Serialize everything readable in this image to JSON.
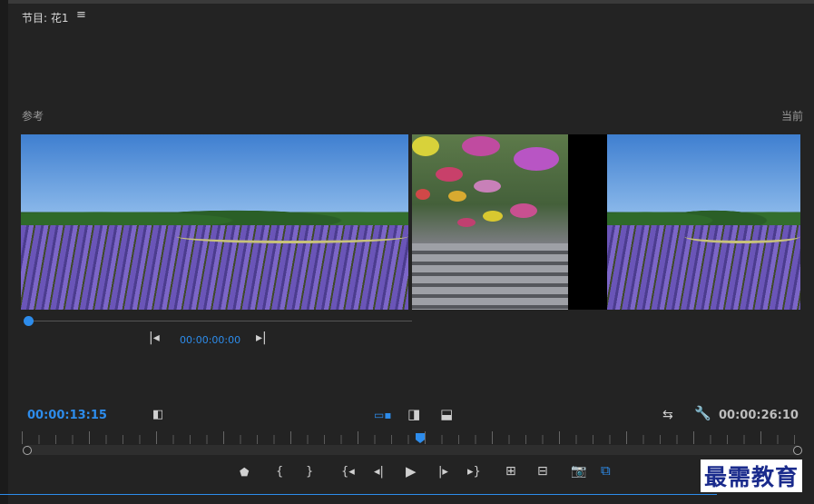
{
  "header": {
    "title": "节目: 花1",
    "menu_icon": "hamburger-icon"
  },
  "labels": {
    "reference": "参考",
    "current": "当前"
  },
  "reference_panel": {
    "timecode": "00:00:00:00",
    "playhead_progress": 0
  },
  "timecode": {
    "current": "00:00:13:15",
    "duration": "00:00:26:10"
  },
  "timeline": {
    "playhead_progress": 0.51
  },
  "watermark": {
    "text": "最需教育"
  },
  "colors": {
    "accent": "#2d8ceb",
    "background": "#232323"
  },
  "controls": {
    "ref_left": "go-to-in-icon",
    "ref_right": "go-to-out-icon",
    "compare_toggle": "compare-icon",
    "view_side_by_side": "side-by-side-icon",
    "view_vertical": "vertical-split-icon",
    "view_horizontal": "horizontal-split-icon",
    "swap": "swap-icon",
    "settings": "wrench-icon",
    "transport": [
      "marker-icon",
      "mark-in-icon",
      "mark-out-icon",
      "go-to-in-icon",
      "step-back-icon",
      "play-icon",
      "step-forward-icon",
      "go-to-out-icon",
      "lift-icon",
      "extract-icon",
      "export-frame-icon",
      "comparison-view-icon"
    ]
  }
}
